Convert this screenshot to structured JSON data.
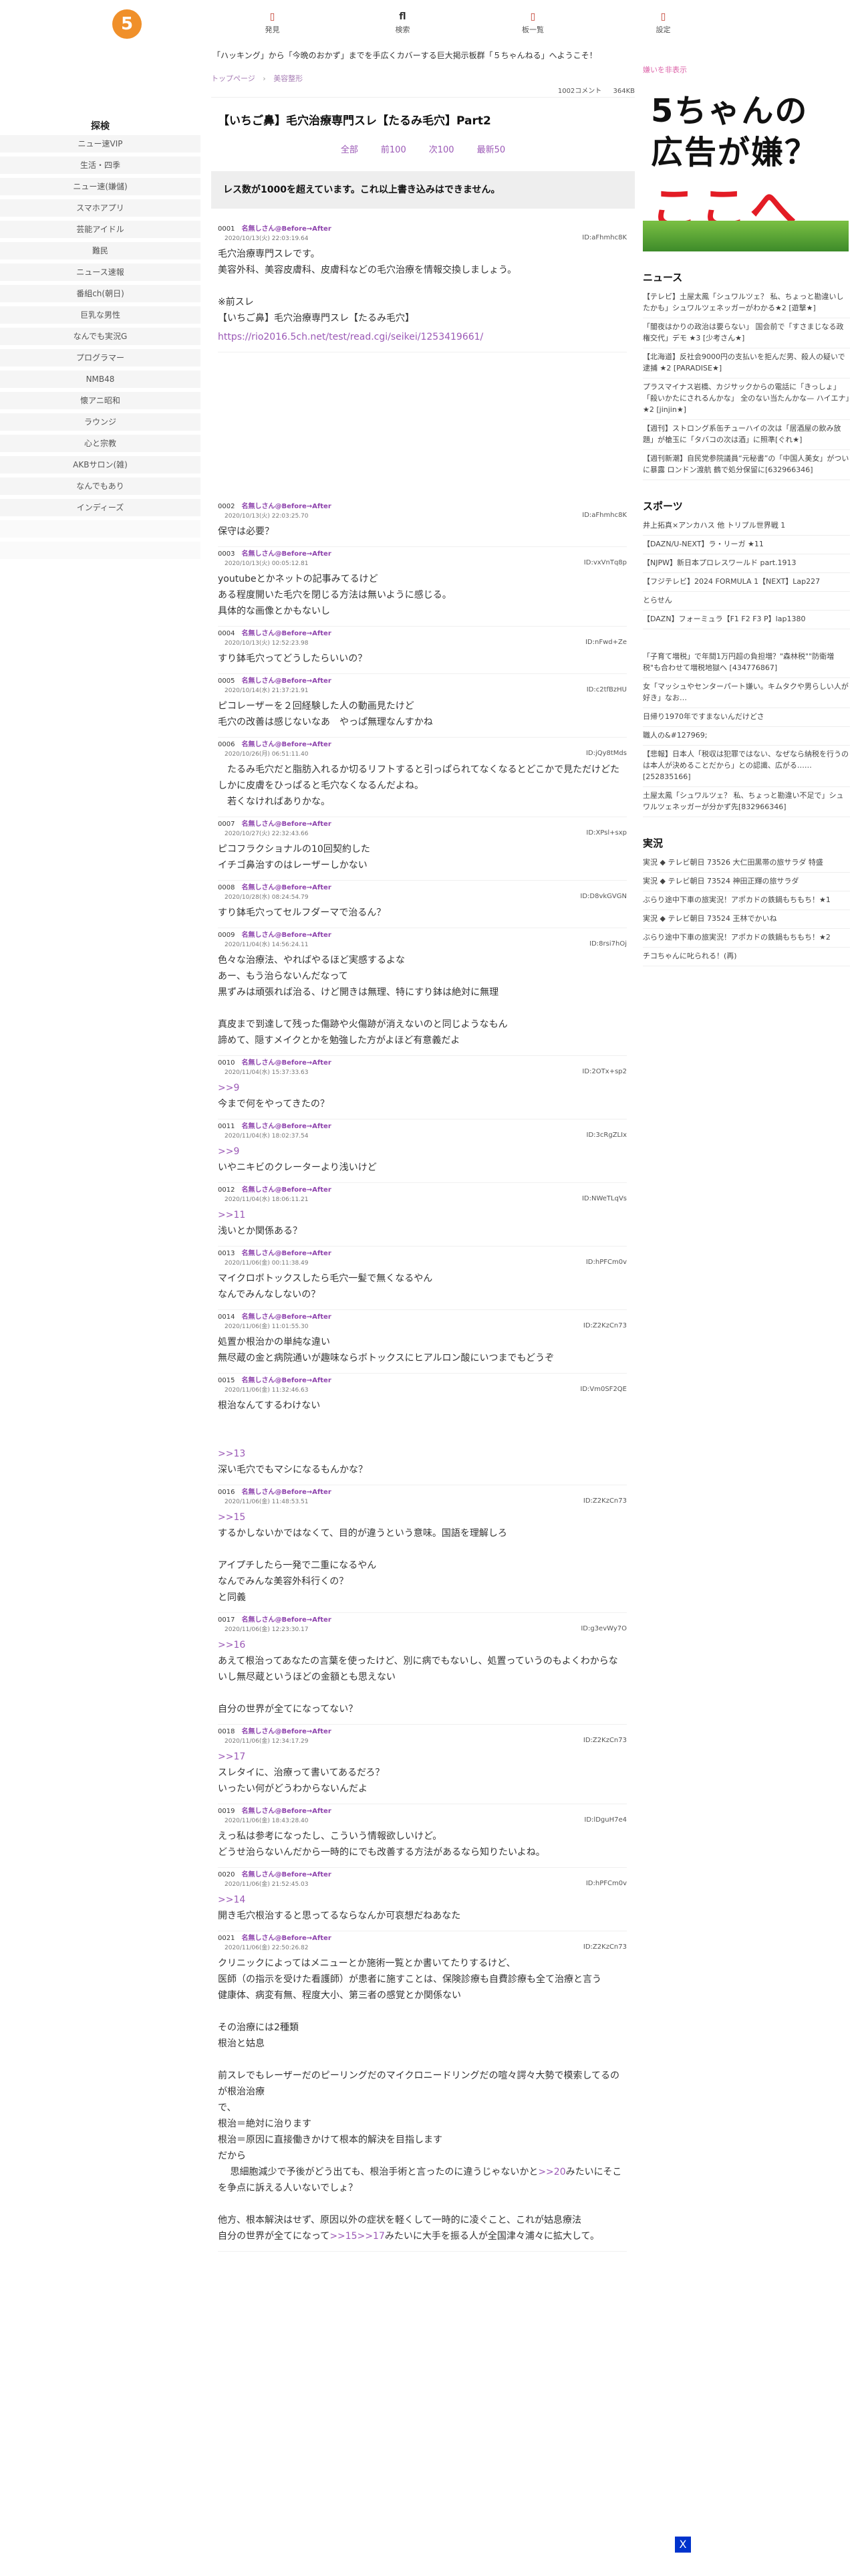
{
  "logo": "5",
  "nav": [
    {
      "icon": "▯",
      "label": "発見"
    },
    {
      "icon": "fl",
      "label": "検索"
    },
    {
      "icon": "▯",
      "label": "板一覧"
    },
    {
      "icon": "▯",
      "label": "設定"
    }
  ],
  "banner": "「ハッキング」から「今晩のおかず」までを手広くカバーする巨大掲示板群「５ちゃんねる」へようこそ！",
  "categories": {
    "title": "探検",
    "items": [
      "ニュー速VIP",
      "生活・四季",
      "ニュー速(嫌儲)",
      "スマホアプリ",
      "芸能アイドル",
      "難民",
      "ニュース速報",
      "番組ch(朝日)",
      "巨乳な男性",
      "なんでも実況G",
      "プログラマー",
      "NMB48",
      "懐アニ昭和",
      "ラウンジ",
      "心と宗教",
      "AKBサロン(雑)",
      "なんでもあり",
      "インディーズ"
    ]
  },
  "breadcrumb": {
    "top": "トップページ",
    "board": "美容整形"
  },
  "meta": {
    "comments": "1002コメント",
    "size": "364KB"
  },
  "thread_title": "【いちご鼻】毛穴治療専門スレ【たるみ毛穴】Part2",
  "pager": {
    "all": "全部",
    "prev": "前100",
    "next": "次100",
    "latest": "最新50"
  },
  "notice": "レス数が1000を超えています。これ以上書き込みはできません。",
  "posts": [
    {
      "num": "0001",
      "name": "名無しさん@Before→After",
      "date": "2020/10/13(火) 22:03:19.64",
      "id": "ID:aFhmhc8K",
      "body": "毛穴治療専門スレです。\n美容外科、美容皮膚科、皮膚科などの毛穴治療を情報交換しましょう。\n\n※前スレ\n【いちご鼻】毛穴治療専門スレ【たるみ毛穴】",
      "link": "https://rio2016.5ch.net/test/read.cgi/seikei/1253419661/"
    },
    {
      "num": "0002",
      "name": "名無しさん@Before→After",
      "date": "2020/10/13(火) 22:03:25.70",
      "id": "ID:aFhmhc8K",
      "body": "保守は必要？"
    },
    {
      "num": "0003",
      "name": "名無しさん@Before→After",
      "date": "2020/10/13(火) 00:05:12.81",
      "id": "ID:vxVnTq8p",
      "body": "youtubeとかネットの記事みてるけど\nある程度開いた毛穴を閉じる方法は無いように感じる。\n具体的な画像とかもないし"
    },
    {
      "num": "0004",
      "name": "名無しさん@Before→After",
      "date": "2020/10/13(火) 12:52:23.98",
      "id": "ID:nFwd+Ze",
      "body": "すり鉢毛穴ってどうしたらいいの？"
    },
    {
      "num": "0005",
      "name": "名無しさん@Before→After",
      "date": "2020/10/14(水) 21:37:21.91",
      "id": "ID:c2tfBzHU",
      "body": "ピコレーザーを２回経験した人の動画見たけど\n毛穴の改善は感じないなあ　やっぱ無理なんすかね"
    },
    {
      "num": "0006",
      "name": "名無しさん@Before→After",
      "date": "2020/10/26(月) 06:51:11.40",
      "id": "ID:jQy8tMds",
      "body": "　たるみ毛穴だと脂肪入れるか切るリフトすると引っぱられてなくなるとどこかで見ただけどたしかに皮膚をひっぱると毛穴なくなるんだよね。\n　若くなければありかな。"
    },
    {
      "num": "0007",
      "name": "名無しさん@Before→After",
      "date": "2020/10/27(火) 22:32:43.66",
      "id": "ID:XPsl+sxp",
      "body": "ピコフラクショナルの10回契約した\nイチゴ鼻治すのはレーザーしかない"
    },
    {
      "num": "0008",
      "name": "名無しさん@Before→After",
      "date": "2020/10/28(水) 08:24:54.79",
      "id": "ID:D8vkGVGN",
      "body": "すり鉢毛穴ってセルフダーマで治るん？"
    },
    {
      "num": "0009",
      "name": "名無しさん@Before→After",
      "date": "2020/11/04(水) 14:56:24.11",
      "id": "ID:8rsi7hOj",
      "body": "色々な治療法、やればやるほど実感するよな\nあー、もう治らないんだなって\n黒ずみは頑張れば治る、けど開きは無理、特にすり鉢は絶対に無理\n\n真皮まで到達して残った傷跡や火傷跡が消えないのと同じようなもん\n諦めて、隠すメイクとかを勉強した方がよほど有意義だよ"
    },
    {
      "num": "0010",
      "name": "名無しさん@Before→After",
      "date": "2020/11/04(水) 15:37:33.63",
      "id": "ID:2OTx+sp2",
      "body": ">>9\n今まで何をやってきたの？"
    },
    {
      "num": "0011",
      "name": "名無しさん@Before→After",
      "date": "2020/11/04(水) 18:02:37.54",
      "id": "ID:3cRgZLIx",
      "body": ">>9\nいやニキビのクレーターより浅いけど"
    },
    {
      "num": "0012",
      "name": "名無しさん@Before→After",
      "date": "2020/11/04(水) 18:06:11.21",
      "id": "ID:NWeTLqVs",
      "body": ">>11\n浅いとか関係ある？"
    },
    {
      "num": "0013",
      "name": "名無しさん@Before→After",
      "date": "2020/11/06(金) 00:11:38.49",
      "id": "ID:hPFCm0v",
      "body": "マイクロボトックスしたら毛穴一髪で無くなるやん\nなんでみんなしないの？"
    },
    {
      "num": "0014",
      "name": "名無しさん@Before→After",
      "date": "2020/11/06(金) 11:01:55.30",
      "id": "ID:Z2KzCn73",
      "body": "処置か根治かの単純な違い\n無尽蔵の金と病院通いが趣味ならボトックスにヒアルロン酸にいつまでもどうぞ"
    },
    {
      "num": "0015",
      "name": "名無しさん@Before→After",
      "date": "2020/11/06(金) 11:32:46.63",
      "id": "ID:Vm0SF2QE",
      "body": "根治なんてするわけない\n\n\n>>13\n深い毛穴でもマシになるもんかな？"
    },
    {
      "num": "0016",
      "name": "名無しさん@Before→After",
      "date": "2020/11/06(金) 11:48:53.51",
      "id": "ID:Z2KzCn73",
      "body": ">>15\nするかしないかではなくて、目的が違うという意味。国語を理解しろ\n\nアイプチしたら一発で二重になるやん\nなんでみんな美容外科行くの？\nと同義"
    },
    {
      "num": "0017",
      "name": "名無しさん@Before→After",
      "date": "2020/11/06(金) 12:23:30.17",
      "id": "ID:g3evWy7O",
      "body": ">>16\nあえて根治ってあなたの言葉を使ったけど、別に病でもないし、処置っていうのもよくわからないし無尽蔵というほどの金額とも思えない\n\n自分の世界が全てになってない？"
    },
    {
      "num": "0018",
      "name": "名無しさん@Before→After",
      "date": "2020/11/06(金) 12:34:17.29",
      "id": "ID:Z2KzCn73",
      "body": ">>17\nスレタイに、治療って書いてあるだろ？\nいったい何がどうわからないんだよ"
    },
    {
      "num": "0019",
      "name": "名無しさん@Before→After",
      "date": "2020/11/06(金) 18:43:28.40",
      "id": "ID:lDguH7e4",
      "body": "えっ私は参考になったし、こういう情報欲しいけど。\nどうせ治らないんだから一時的にでも改善する方法があるなら知りたいよね。"
    },
    {
      "num": "0020",
      "name": "名無しさん@Before→After",
      "date": "2020/11/06(金) 21:52:45.03",
      "id": "ID:hPFCm0v",
      "body": ">>14\n開き毛穴根治すると思ってるならなんか可哀想だねあなた"
    },
    {
      "num": "0021",
      "name": "名無しさん@Before→After",
      "date": "2020/11/06(金) 22:50:26.82",
      "id": "ID:Z2KzCn73",
      "body": "クリニックによってはメニューとか施術一覧とか書いてたりするけど、\n医師（の指示を受けた看護師）が患者に施すことは、保険診療も自費診療も全て治療と言う\n健康体、病変有無、程度大小、第三者の感覚とか関係ない\n\nその治療には2種類\n根治と姑息\n\n前スレでもレーザーだのピーリングだのマイクロニードリングだの喧々諤々大勢で模索してるのが根治治療\nで、\n根治＝絶対に治ります\n根治＝原因に直接働きかけて根本的解決を目指します\nだから\n　 思細胞減少で予後がどう出ても、根治手術と言ったのに違うじゃないかと>>20みたいにそこを争点に訴える人いないでしょ？\n\n他方、根本解決はせず、原因以外の症状を軽くして一時的に凌ぐこと、これが姑息療法\n自分の世界が全てになって>>15>>17みたいに大手を振る人が全国津々浦々に拡大して。"
    }
  ],
  "ad": {
    "label": "嫌いを非表示",
    "line1": "5ちゃんの",
    "line2": "広告が嫌？",
    "line3": "ここへ"
  },
  "news": {
    "title": "ニュース",
    "items": [
      "【テレビ】土屋太鳳「シュワルツェ？ 私、ちょっと勘違いしたかも」シュワルツェネッガーがわかる★2 [遊撃★]",
      "「闇夜はかりの政治は要らない」 国会前で「すさまじなる政権交代」デモ ★3 [少考さん★]",
      "【北海道】反社会9000円の支払いを拒んだ男、殺人の疑いで逮捕 ★2 [PARADISE★]",
      "プラスマイナス岩橋、カジサックからの電話に「きっしょ」「殺いかたにされるんかな」 全のない当たんかな— ハイエナ」★2 [jinjin★]",
      "【週刊】ストロング系缶チューハイの次は「居酒屋の飲み放題」が槍玉に「タバコの次は酒」に照準[ぐれ★]",
      "【週刊新潮】自民党参院議員“元秘書”の「中国人美女」がついに暴露 ロンドン渡航 鶴で処分保留に[632966346]"
    ]
  },
  "sports": {
    "title": "スポーツ",
    "items": [
      "井上拓真×アンカハス 他 トリプル世界戦 1",
      "【DAZN/U-NEXT】ラ・リーガ ★11",
      "【NJPW】新日本プロレスワールド part.1913",
      "【フジテレビ】2024 FORMULA 1【NEXT】Lap227",
      "とらせん",
      "【DAZN】フォーミュラ【F1 F2 F3 P】lap1380"
    ]
  },
  "misc": {
    "items": [
      "「子育て増税」で年間1万円超の負担増？\"森林税\"\"防衛増税\"も合わせて増税地獄へ [434776867]",
      "女「マッシュやセンターパート嫌い。キムタクや男らしい人が好き」なお…",
      "日帰り1970年ですまないんだけどさ",
      "職人の&#127969;",
      "【悲報】日本人「税収は犯罪ではない、なぜなら納税を行うのは本人が決めることだから」との認識、広がる…… [252835166]",
      "土屋太鳳「シュワルツェ？ 私、ちょっと勘違い不足で」シュワルツェネッガーが分かず先[832966346]"
    ]
  },
  "live": {
    "title": "実況",
    "items": [
      "実況 ◆ テレビ朝日 73526 大仁田黒帯の旅サラダ 特盛",
      "実況 ◆ テレビ朝日 73524 神田正輝の旅サラダ",
      "ぶらり途中下車の旅実況！アポカドの鉄鍋もちもち！★1",
      "実況 ◆ テレビ朝日 73524 王林でかいね",
      "ぶらり途中下車の旅実況！アポカドの鉄鍋もちもち！★2",
      "チコちゃんに叱られる！(再)"
    ]
  },
  "bottom_icon": "X"
}
